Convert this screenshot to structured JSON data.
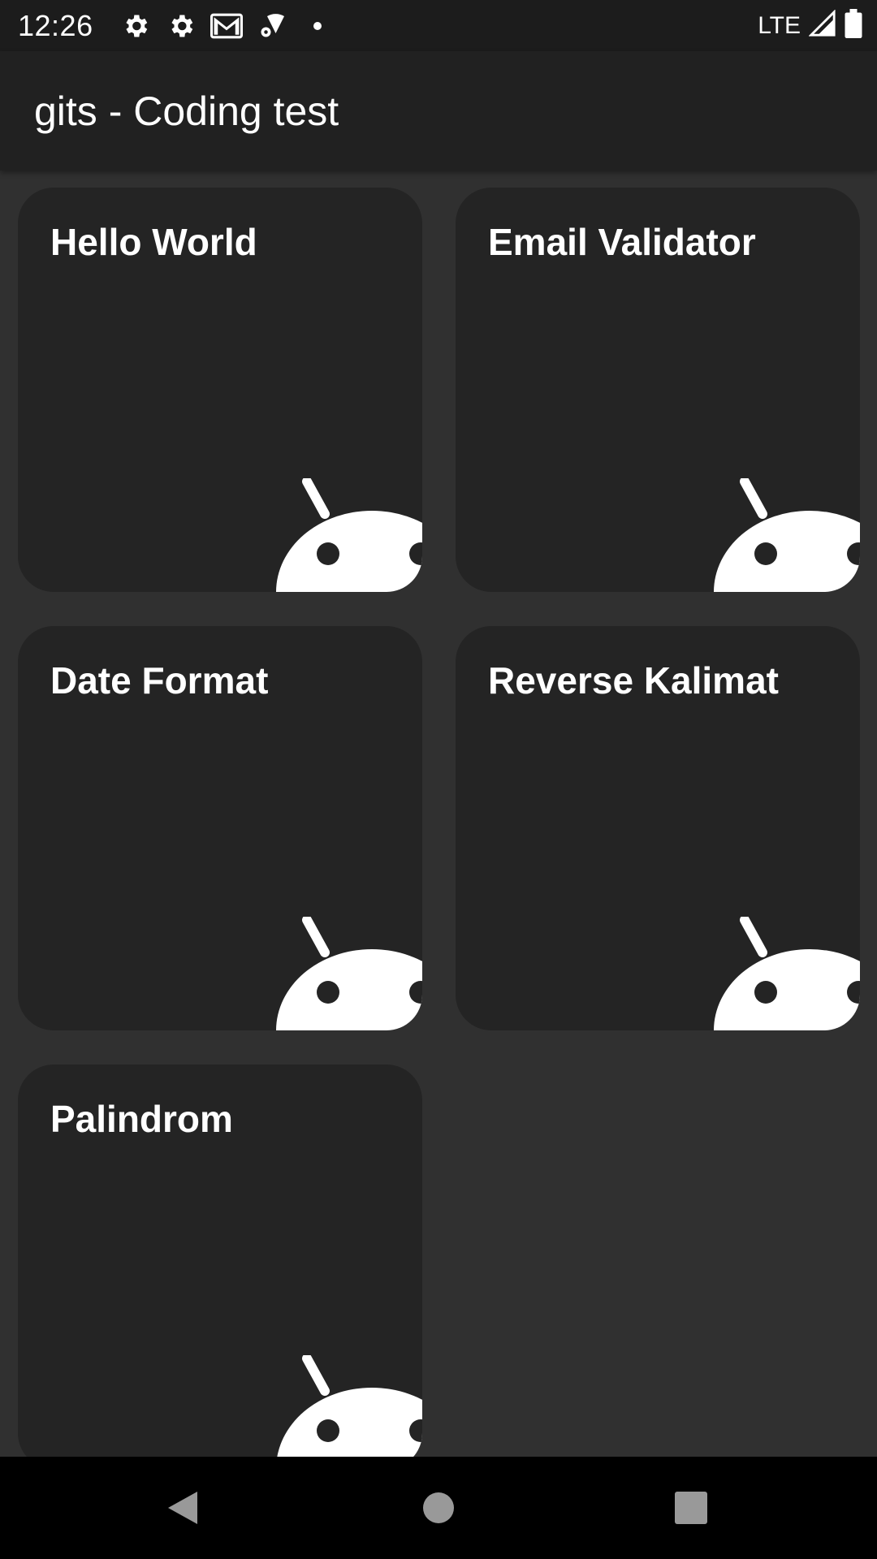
{
  "status_bar": {
    "time": "12:26",
    "network": "LTE",
    "icons": [
      "settings-icon",
      "settings-icon",
      "gmail-icon",
      "wifi-settings-icon",
      "dot-icon",
      "signal-icon",
      "battery-icon"
    ]
  },
  "app_bar": {
    "title": "gits - Coding test"
  },
  "cards": [
    {
      "title": "Hello World",
      "icon": "android-icon"
    },
    {
      "title": "Email Validator",
      "icon": "android-icon"
    },
    {
      "title": "Date Format",
      "icon": "android-icon"
    },
    {
      "title": "Reverse Kalimat",
      "icon": "android-icon"
    },
    {
      "title": "Palindrom",
      "icon": "android-icon"
    }
  ],
  "nav_bar": {
    "icons": [
      "back-icon",
      "home-icon",
      "recents-icon"
    ]
  },
  "colors": {
    "background": "#303030",
    "status_bar": "#1c1c1c",
    "app_bar": "#212121",
    "card": "#242424",
    "text": "#ffffff",
    "nav_bar": "#000000"
  }
}
